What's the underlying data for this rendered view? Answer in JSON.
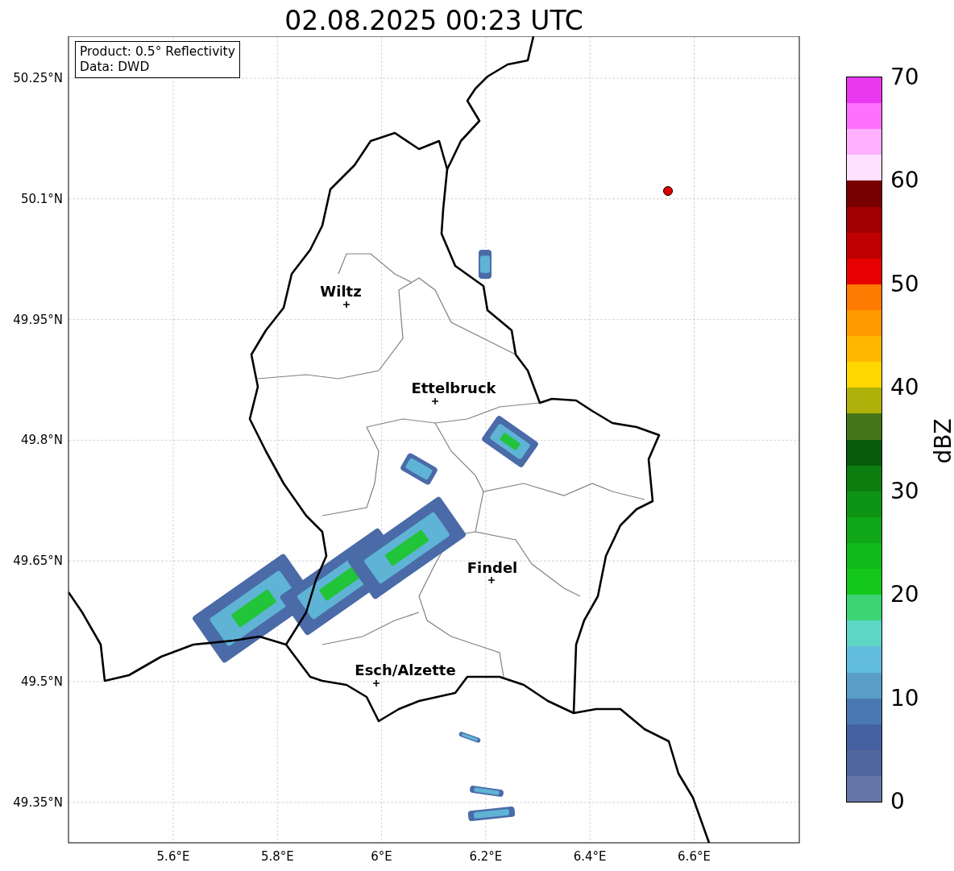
{
  "title": "02.08.2025 00:23 UTC",
  "info_box": {
    "lines": [
      "Product: 0.5° Reflectivity",
      "Data: DWD"
    ]
  },
  "map": {
    "lat_ticks": [
      "50.25°N",
      "50.1°N",
      "49.95°N",
      "49.8°N",
      "49.65°N",
      "49.5°N",
      "49.35°N"
    ],
    "lon_ticks": [
      "5.6°E",
      "5.8°E",
      "6°E",
      "6.2°E",
      "6.4°E",
      "6.6°E"
    ],
    "cities": [
      {
        "name": "Wiltz"
      },
      {
        "name": "Ettelbruck"
      },
      {
        "name": "Findel"
      },
      {
        "name": "Esch/Alzette"
      }
    ]
  },
  "colorbar": {
    "label": "dBZ",
    "ticks": [
      "70",
      "60",
      "50",
      "40",
      "30",
      "20",
      "10",
      "0"
    ],
    "segments": [
      {
        "color": "#e838f0"
      },
      {
        "color": "#ff70ff"
      },
      {
        "color": "#ffb0ff"
      },
      {
        "color": "#ffe0ff"
      },
      {
        "color": "#780000"
      },
      {
        "color": "#a00000"
      },
      {
        "color": "#c00000"
      },
      {
        "color": "#e60000"
      },
      {
        "color": "#ff7a00"
      },
      {
        "color": "#ff9a00"
      },
      {
        "color": "#ffb800"
      },
      {
        "color": "#ffd700"
      },
      {
        "color": "#b0b00a"
      },
      {
        "color": "#44761a"
      },
      {
        "color": "#065a0a"
      },
      {
        "color": "#0c7e10"
      },
      {
        "color": "#0e9414"
      },
      {
        "color": "#10a818"
      },
      {
        "color": "#10b81a"
      },
      {
        "color": "#13c81a"
      },
      {
        "color": "#3dd475"
      },
      {
        "color": "#5dd6c5"
      },
      {
        "color": "#63bedd"
      },
      {
        "color": "#5a9ec8"
      },
      {
        "color": "#4a78b0"
      },
      {
        "color": "#4560a0"
      },
      {
        "color": "#52669e"
      },
      {
        "color": "#6575a8"
      }
    ]
  }
}
